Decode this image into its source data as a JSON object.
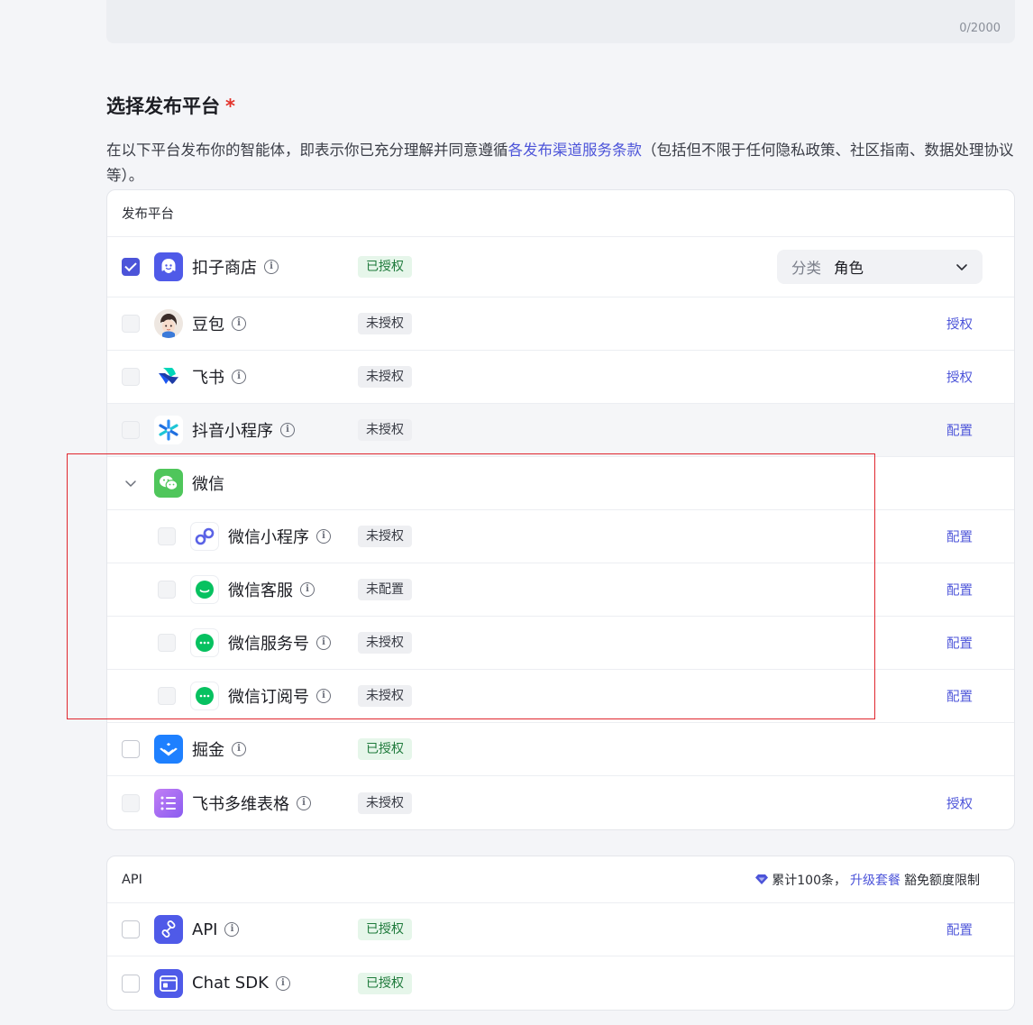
{
  "textarea": {
    "char_count": "0/2000"
  },
  "section": {
    "title": "选择发布平台",
    "required_mark": "*",
    "description_before": "在以下平台发布你的智能体，即表示你已充分理解并同意遵循",
    "description_link": "各发布渠道服务条款",
    "description_after": "（包括但不限于任何隐私政策、社区指南、数据处理协议等）。"
  },
  "platform_card": {
    "header": "发布平台",
    "coze_store": {
      "name": "扣子商店",
      "status": "已授权",
      "category_label": "分类",
      "category_value": "角色"
    },
    "doubao": {
      "name": "豆包",
      "status": "未授权",
      "action": "授权"
    },
    "feishu": {
      "name": "飞书",
      "status": "未授权",
      "action": "授权"
    },
    "douyin": {
      "name": "抖音小程序",
      "status": "未授权",
      "action": "配置"
    },
    "wechat_group": {
      "name": "微信"
    },
    "wechat_mini": {
      "name": "微信小程序",
      "status": "未授权",
      "action": "配置"
    },
    "wechat_kf": {
      "name": "微信客服",
      "status": "未配置",
      "action": "配置"
    },
    "wechat_service": {
      "name": "微信服务号",
      "status": "未授权",
      "action": "配置"
    },
    "wechat_sub": {
      "name": "微信订阅号",
      "status": "未授权",
      "action": "配置"
    },
    "juejin": {
      "name": "掘金",
      "status": "已授权"
    },
    "feishu_base": {
      "name": "飞书多维表格",
      "status": "未授权",
      "action": "授权"
    }
  },
  "api_card": {
    "header": "API",
    "quota_before": "累计100条，",
    "quota_link": "升级套餐",
    "quota_after": "豁免额度限制",
    "api": {
      "name": "API",
      "status": "已授权",
      "action": "配置"
    },
    "chat_sdk": {
      "name": "Chat SDK",
      "status": "已授权"
    }
  },
  "colors": {
    "accent": "#4c54d9",
    "authorized_bg": "#e6f6ea",
    "highlight": "#e0262e"
  },
  "icons": [
    "coze-store-icon",
    "doubao-icon",
    "feishu-icon",
    "douyin-icon",
    "wechat-icon",
    "wechat-mini-icon",
    "wechat-kf-icon",
    "wechat-service-icon",
    "wechat-sub-icon",
    "juejin-icon",
    "feishu-base-icon",
    "api-icon",
    "chat-sdk-icon",
    "info-icon",
    "chevron-down-icon",
    "diamond-icon"
  ]
}
